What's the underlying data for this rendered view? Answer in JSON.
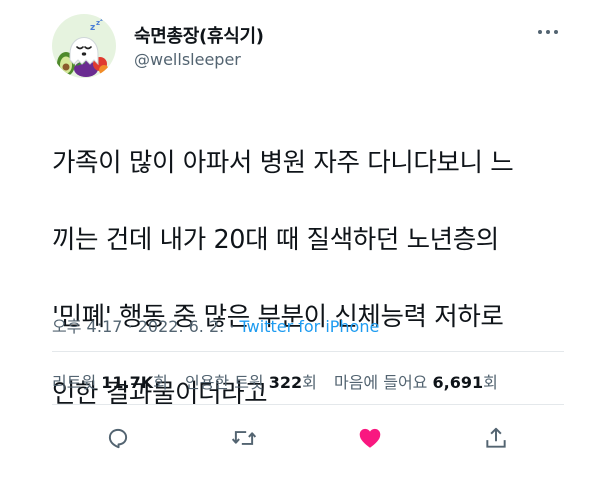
{
  "user": {
    "display_name": "숙면총장(휴식기)",
    "handle": "@wellsleeper",
    "avatar": "sleeping-ghost-avatar"
  },
  "tweet": {
    "lines": [
      "가족이 많이 아파서 병원 자주 다니다보니 느",
      "끼는 건데 내가 20대 때 질색하던 노년층의",
      "'민폐' 행동 중 많은 부분이 신체능력 저하로",
      "인한 결과물이더라고"
    ]
  },
  "meta": {
    "time": "오후 4:17",
    "separator": " · ",
    "date": "2022. 6. 2.",
    "source": "Twitter for iPhone"
  },
  "stats": {
    "retweets_label": "리트윗",
    "retweets_value": "11.7K",
    "retweets_suffix": "회",
    "quotes_label": "인용한 트윗",
    "quotes_value": "322",
    "quotes_suffix": "회",
    "likes_label": "마음에 들어요",
    "likes_value": "6,691",
    "likes_suffix": "회"
  },
  "actions": {
    "reply": "reply-icon",
    "retweet": "retweet-icon",
    "like": "heart-icon",
    "share": "share-icon"
  },
  "colors": {
    "accent": "#1d9bf0",
    "like": "#f91880",
    "secondary_text": "#536471",
    "primary_text": "#0f1419"
  }
}
